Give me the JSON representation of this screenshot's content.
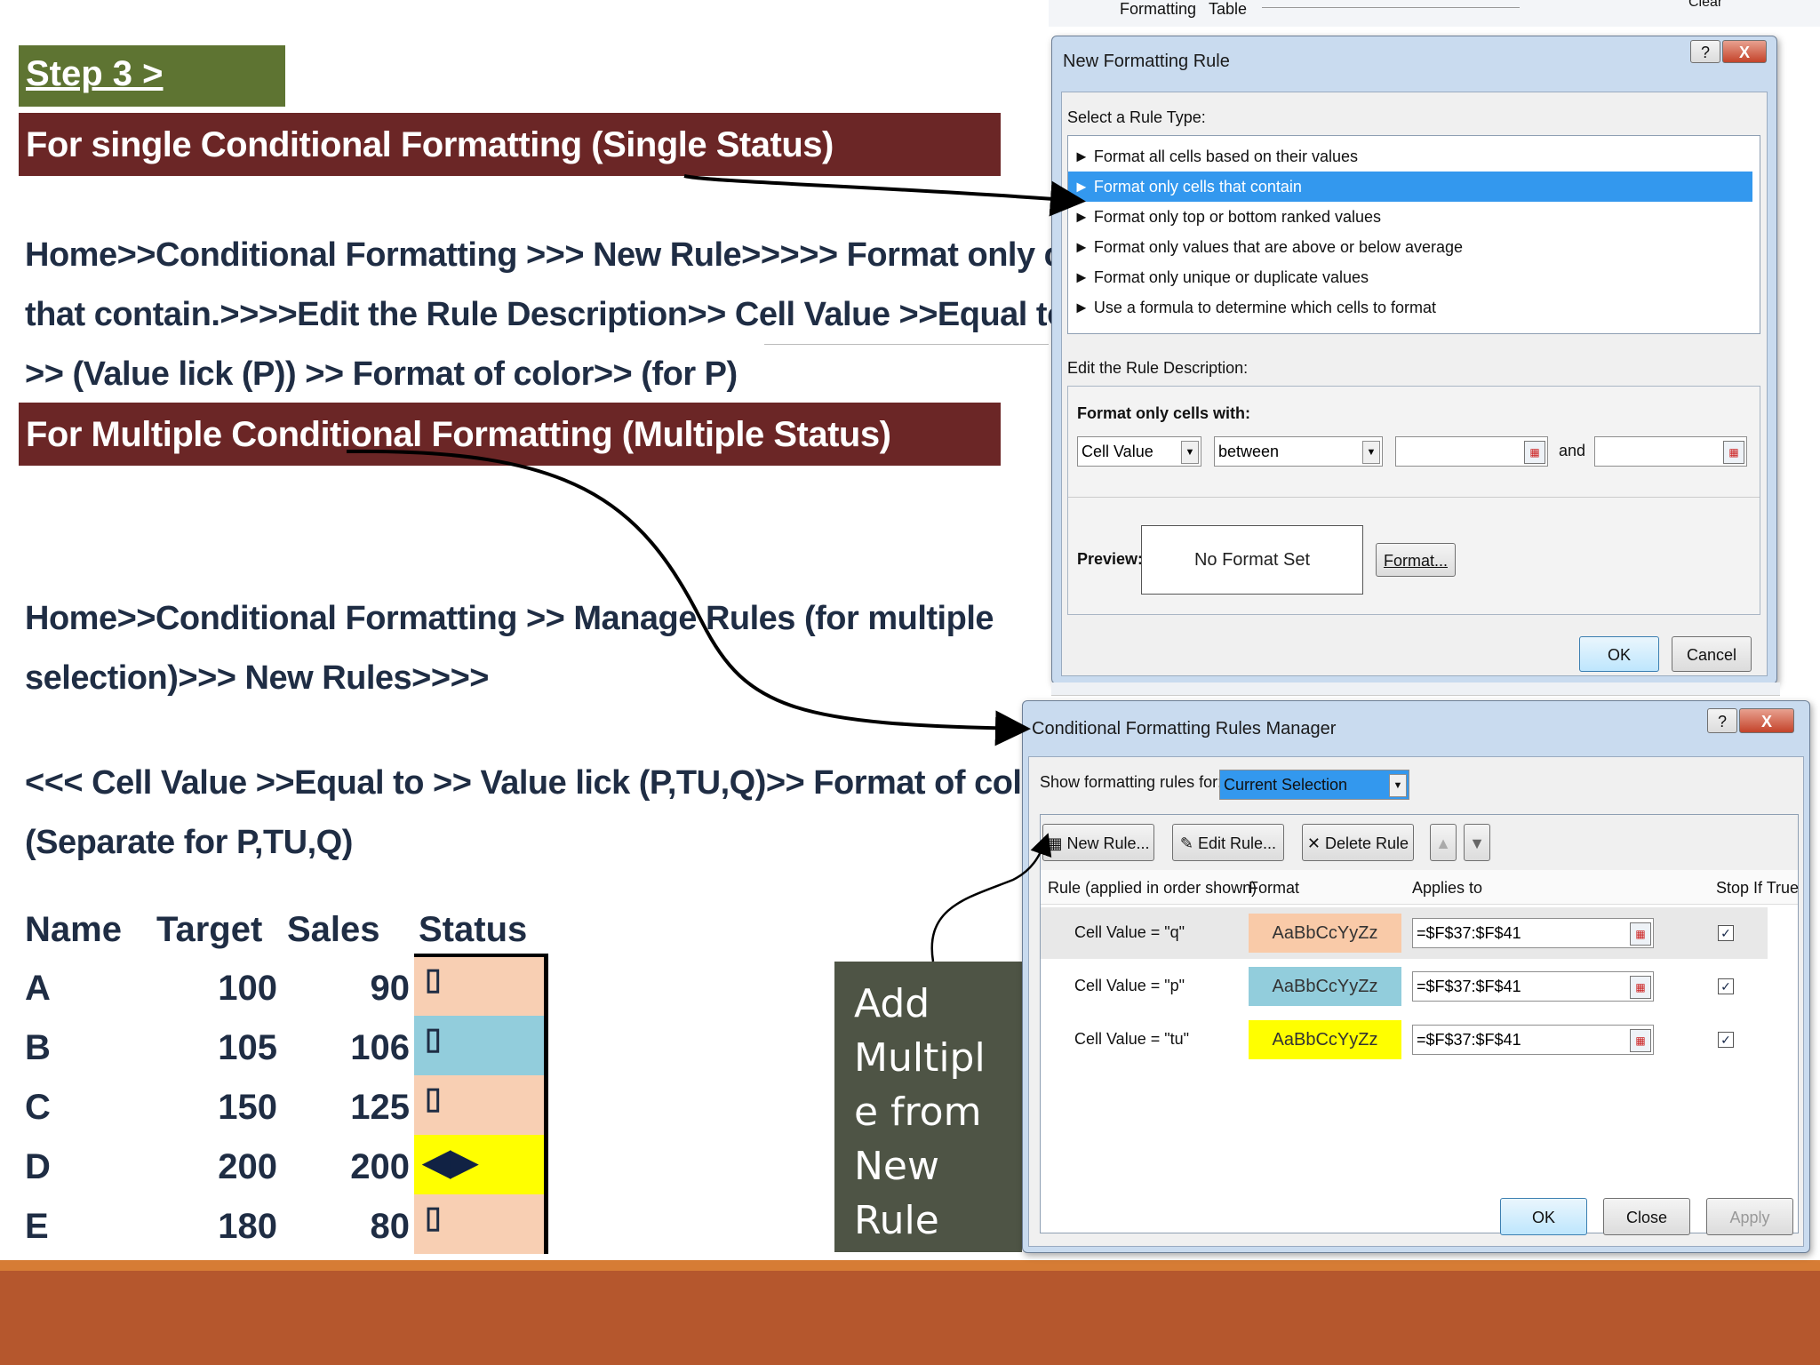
{
  "slide": {
    "step_label": "Step 3 >",
    "banner_single": "For single Conditional Formatting (Single Status)",
    "single_lines": [
      "Home>>Conditional Formatting >>> New Rule>>>>> Format only cells",
      "that contain.>>>>Edit the Rule Description>> Cell Value >>Equal to",
      ">>  (Value lick (P)) >> Format of color>> (for P)"
    ],
    "banner_multiple": "For Multiple Conditional Formatting (Multiple  Status)",
    "multiple_lines": [
      "Home>>Conditional Formatting >>  Manage Rules (for multiple",
      "selection)>>> New Rules>>>>"
    ],
    "value_lines": [
      "<<<  Cell Value >>Equal to >>  Value lick (P,TU,Q)>> Format of color>>",
      "(Separate for P,TU,Q)"
    ],
    "callout_lines": [
      "Add",
      "Multipl",
      "e from",
      "New",
      "Rule"
    ]
  },
  "status_table": {
    "headers": [
      "Name",
      "Target",
      "Sales",
      "Status"
    ],
    "rows": [
      {
        "name": "A",
        "target": "100",
        "sales": "90",
        "status_glyph": "▯",
        "color": "#f8cfb3"
      },
      {
        "name": "B",
        "target": "105",
        "sales": "106",
        "status_glyph": "▯",
        "color": "#92cddc"
      },
      {
        "name": "C",
        "target": "150",
        "sales": "125",
        "status_glyph": "▯",
        "color": "#f8cfb3"
      },
      {
        "name": "D",
        "target": "200",
        "sales": "200",
        "status_glyph": "◀▶",
        "color": "#ffff00"
      },
      {
        "name": "E",
        "target": "180",
        "sales": "80",
        "status_glyph": "▯",
        "color": "#f8cfb3"
      }
    ]
  },
  "ribbon_fragment": {
    "formatting": "Formatting",
    "table": "Table",
    "clear": "Clear"
  },
  "new_rule_dialog": {
    "title": "New Formatting Rule",
    "help": "?",
    "close": "X",
    "select_label": "Select a Rule Type:",
    "rule_types": [
      "Format all cells based on their values",
      "Format only cells that contain",
      "Format only top or bottom ranked values",
      "Format only values that are above or below average",
      "Format only unique or duplicate values",
      "Use a formula to determine which cells to format"
    ],
    "selected_index": 1,
    "edit_label": "Edit the Rule Description:",
    "format_only_label": "Format only cells with:",
    "combo1": "Cell Value",
    "combo2": "between",
    "and_label": "and",
    "preview_label": "Preview:",
    "preview_text": "No Format Set",
    "format_button": "Format...",
    "ok": "OK",
    "cancel": "Cancel"
  },
  "manager_dialog": {
    "title": "Conditional Formatting Rules Manager",
    "help": "?",
    "close": "X",
    "show_label": "Show formatting rules for:",
    "show_value": "Current Selection",
    "new_rule": "New Rule...",
    "edit_rule": "Edit Rule...",
    "delete_rule": "Delete Rule",
    "columns": [
      "Rule (applied in order shown)",
      "Format",
      "Applies to",
      "Stop If True"
    ],
    "rules": [
      {
        "rule": "Cell Value = \"q\"",
        "format": "AaBbCcYyZz",
        "applies": "=$F$37:$F$41",
        "color": "#f9caa8"
      },
      {
        "rule": "Cell Value = \"p\"",
        "format": "AaBbCcYyZz",
        "applies": "=$F$37:$F$41",
        "color": "#92cddc"
      },
      {
        "rule": "Cell Value = \"tu\"",
        "format": "AaBbCcYyZz",
        "applies": "=$F$37:$F$41",
        "color": "#ffff00"
      }
    ],
    "ok": "OK",
    "close_button": "Close",
    "apply": "Apply"
  }
}
